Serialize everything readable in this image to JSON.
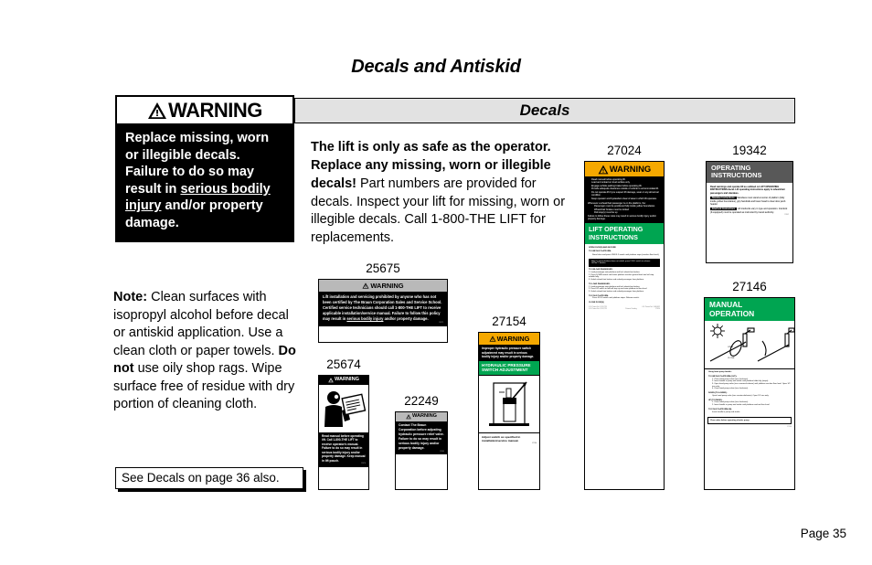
{
  "page": {
    "title": "Decals and Antiskid",
    "page_number": "Page 35"
  },
  "main_warning": {
    "header": "WARNING",
    "line1": "Replace missing, worn",
    "line2": "or illegible decals.",
    "line3": "Failure to do so may",
    "line4a": "result in ",
    "line4b": "serious bodily",
    "line5a": "injury",
    "line5b": " and/or property",
    "line6": "damage."
  },
  "note": {
    "label": "Note:",
    "text1": " Clean surfaces with isopropyl alcohol before decal or antiskid application.  Use a clean cloth or paper towels. ",
    "bold2": "Do not",
    "text2": " use oily shop rags.  Wipe surface free of residue with dry portion of cleaning cloth.",
    "see_also": "See Decals on page 36 also."
  },
  "decals_section": {
    "bar_title": "Decals",
    "intro_bold": "The lift is only as safe as the operator.  Replace any missing, worn or illegible decals!",
    "intro_rest": " Part numbers are provided for decals.  Inspect your lift for missing, worn or illegible decals.  Call 1-800-THE LIFT for replacements."
  },
  "colors": {
    "warning_orange": "#F5A800",
    "green": "#00A551",
    "bar_gray": "#e2e2e2",
    "header_gray": "#b9b9b9",
    "dark_gray": "#585858"
  },
  "decals": [
    {
      "part_number": "25675",
      "header": "WARNING",
      "header_style": "gray",
      "body": "Lift installation and servicing prohibited by anyone who has not been certified by The Braun Corporation Sales and Service School.  Certified service technicians should call 1-800-THE LIFT to receive applicable installation/service manual.  Failure to follow this policy may result in ",
      "body_underline": "serious bodily injury",
      "body_end": " and/or property damage.",
      "footer_code": "25675"
    },
    {
      "part_number": "25674",
      "header": "WARNING",
      "header_style": "black",
      "art": "person-reading-manual",
      "body": "Read manual before operating lift.  Call 1-800-THE LIFT to receive operator's manual.  Failure to do so may result in serious bodily injury and/or property damage.  Keep manual in lift pouch.",
      "footer_code": "25674"
    },
    {
      "part_number": "22249",
      "header": "WARNING",
      "header_style": "gray",
      "body": "Contact The Braun Corporation before adjusting hydraulic pressure relief valve.  Failure to do so may result in serious bodily injury and/or property damage.",
      "footer_code": "22249"
    },
    {
      "part_number": "27154",
      "header": "WARNING",
      "header_style": "orange",
      "body": "Improper hydraulic pressure switch adjustment may result in serious bodily injury and/or property damage.",
      "green_title": "HYDRAULIC PRESSURE SWITCH ADJUSTMENT",
      "art": "pressure-switch-diagram",
      "footer": "Adjust switch as specified in installation/service manual.",
      "footer_code": "27154"
    },
    {
      "part_number": "27024",
      "header": "WARNING",
      "header_style": "orange",
      "bullets": [
        "Read manual before operating lift.",
        "Load and unload on level surface only.",
        "Engage vehicle parking brake before operating lift.",
        "Provide adequate clearance outside of vehicle to accommodate lift.",
        "Do not operate lift if you suspect lift damage, wear or any abnormal condition.",
        "Keep operator and bystanders clear of area in which lift operates."
      ],
      "sub_intro": "Whenever a wheelchair passenger is on the platform, the:",
      "sub_bullets": [
        "Passenger must be positioned fully inside yellow boundaries",
        "Wheelchair brakes must be locked",
        "Roll stop(s) must be up"
      ],
      "sub_close": "Failure to follow these rules may result in serious bodily injury and/or property damage.",
      "green_title": "LIFT OPERATING INSTRUCTIONS",
      "instructions": [
        {
          "type": "head",
          "text": "OPEN DOOR(S) AND SECURE"
        },
        {
          "type": "head",
          "text": "TO UNFOLD PLATFORM:"
        },
        {
          "type": "para",
          "text": "Stand clear and press  UNFOLD switch until platform stops (reaches floor level)."
        },
        {
          "type": "note",
          "text": "Note:  In event platform does not unfold, press  FOLD switch to release LiftTite™ latches."
        },
        {
          "type": "head",
          "text": "TO UNLOAD PASSENGER:"
        },
        {
          "type": "num",
          "text": "1. Load passenger onto platform and lock wheelchair brakes."
        },
        {
          "type": "num",
          "text": "2. Press  DOWN switch until entire platform reaches ground level and roll stop unfolds fully."
        },
        {
          "type": "num",
          "text": "3. Unlock wheelchair brakes and unload passenger from platform."
        },
        {
          "type": "head",
          "text": "TO LOAD PASSENGER:"
        },
        {
          "type": "num",
          "text": "1. Load passenger onto platform and lock wheelchair brakes."
        },
        {
          "type": "num",
          "text": "2. Press  UP switch to fold roll stop up and raise platform to floor level."
        },
        {
          "type": "num",
          "text": "3. Unlock wheelchair brakes and unload passenger from platform."
        },
        {
          "type": "head",
          "text": "TO FOLD PLATFORM:"
        },
        {
          "type": "para",
          "text": "Press  FOLD switch until platform stops.  Release switch."
        },
        {
          "type": "head",
          "text": "CLOSE DOOR(S)"
        }
      ],
      "patent1": "U.S. Patent No. 5,224,723",
      "patent2": "U.S. Patent No. 5,224,723",
      "patent3": "U.S. Patent No. 5,806,632",
      "patent4": "Patents Pending",
      "footer_code": "27024"
    },
    {
      "part_number": "19342",
      "header_line1": "OPERATING",
      "header_line2": "INSTRUCTIONS",
      "header_style": "dark-gray",
      "body": "Read warnings and operate lift as outlined on LIFT OPERATING INSTRUCTIONS decal.  Lift operating instructions apply to wheelchair passengers and standees.",
      "label1": "Standee Instructions",
      "body1": "  Standees must stand at center of platform (fully inside yellow boundaries), grip handrails and lower head to clear door jamb header.",
      "label2": "Interlock Instructions",
      "body2": "  Lift interlocks vary in type and operation.  Interlock (if equipped) must be operated as instructed by transit authority.",
      "footer_code": "19342"
    },
    {
      "part_number": "27146",
      "header_line1": "MANUAL",
      "header_line2": "OPERATION",
      "header_style": "green",
      "art": "hand-pump-diagrams",
      "art_labels": [
        "OPEN",
        "CLOSE"
      ],
      "intro": "Using hand pump handle:",
      "sections": [
        {
          "head": "TO UNFOLD PLATFORM (OUT):",
          "items": [
            "1. Close hand pump valve (turn clockwise).",
            "2. Insert handle in pump and stroke until platform folds fully (stops).",
            "3. Open hand pump valve (turn counterclockwise) until platform reaches floor level.  Open 1/2 turn only.",
            "4. Close hand pump valve (turn clockwise)."
          ]
        },
        {
          "head": "DOWN (TO LOWER):",
          "items": [
            "Open hand pump valve (turn counterclockwise).  Open 1/2 turn only."
          ]
        },
        {
          "head": "UP (TO RAISE):",
          "items": [
            "1. Close hand pump valve (turn clockwise).",
            "2. Insert handle in pump and stroke until platform reaches floor level."
          ]
        },
        {
          "head": "TO FOLD PLATFORM (IN):",
          "items": [
            "Insert handle in pump and stroke."
          ]
        }
      ],
      "boxed_note": "Close valve before operating electric pump.",
      "footer_code": "27146"
    }
  ]
}
